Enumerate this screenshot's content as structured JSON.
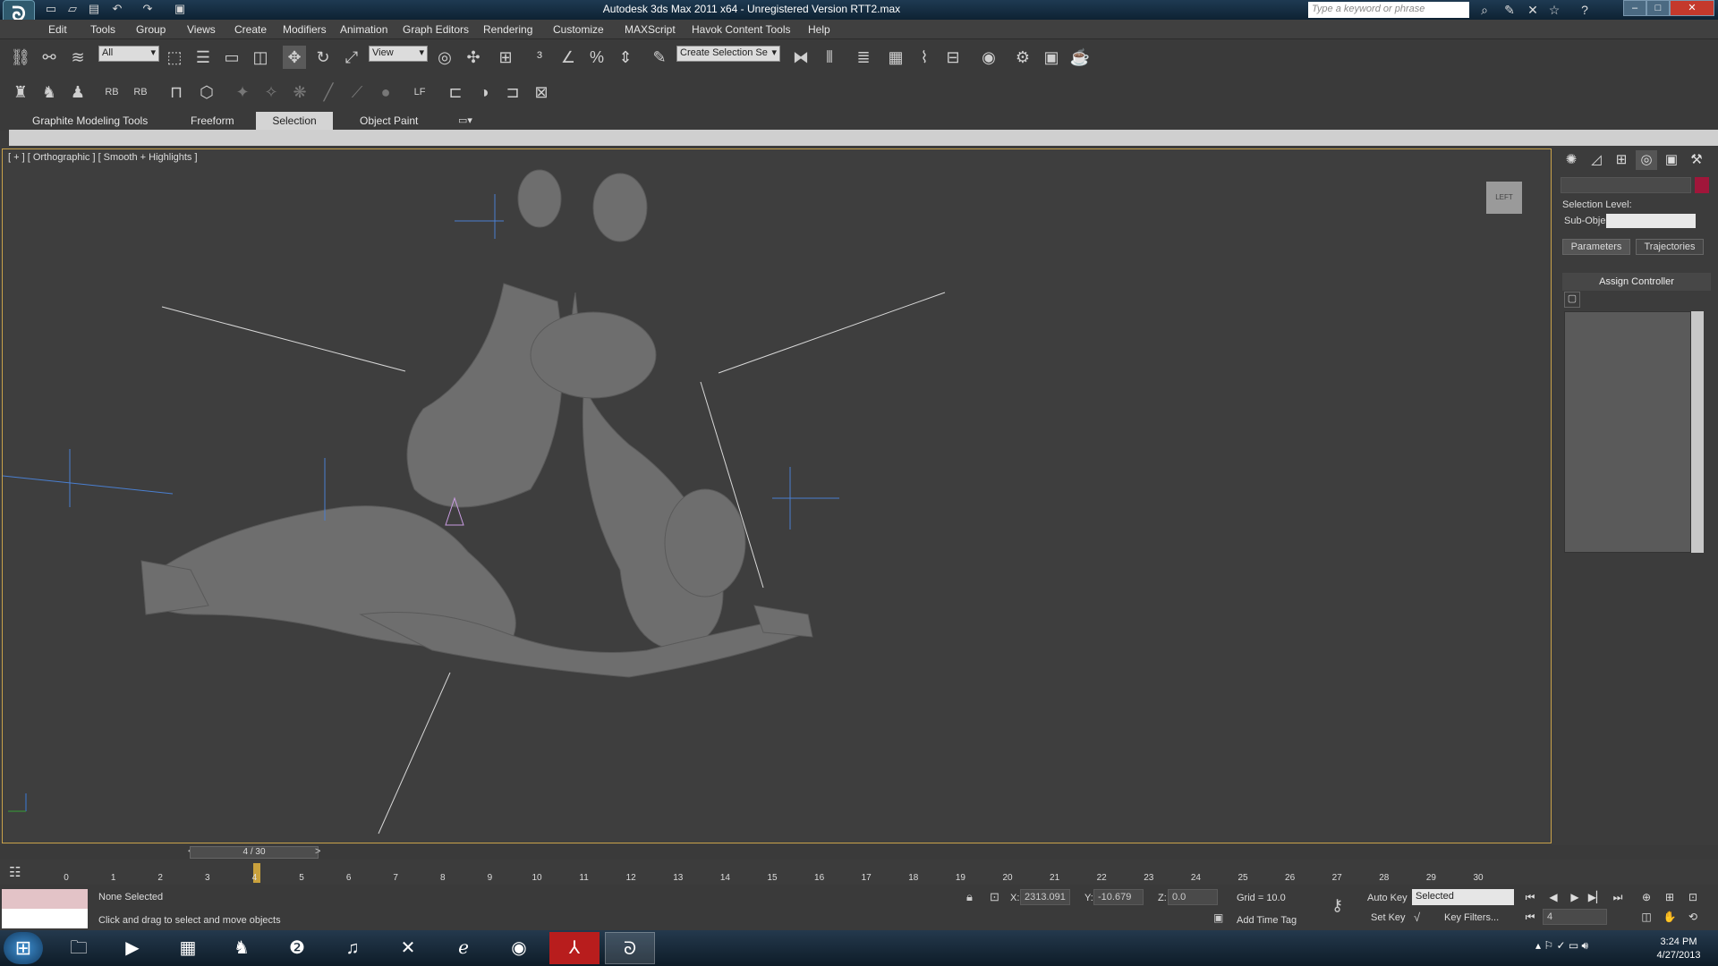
{
  "window": {
    "title": "Autodesk 3ds Max  2011 x64  -  Unregistered Version    RTT2.max",
    "search_placeholder": "Type a keyword or phrase"
  },
  "menu": [
    "Edit",
    "Tools",
    "Group",
    "Views",
    "Create",
    "Modifiers",
    "Animation",
    "Graph Editors",
    "Rendering",
    "Customize",
    "MAXScript",
    "Havok Content Tools",
    "Help"
  ],
  "toolbar": {
    "selection_filter": "All",
    "ref_coord": "View",
    "named_selection": "Create Selection Se"
  },
  "ribbon": {
    "tabs": [
      "Graphite Modeling Tools",
      "Freeform",
      "Selection",
      "Object Paint"
    ],
    "active": "Selection"
  },
  "viewport": {
    "label": "[ + ] [ Orthographic ] [ Smooth + Highlights ]",
    "viewcube": "LEFT"
  },
  "command_panel": {
    "selection_level": "Selection Level:",
    "sub_object": "Sub-Object",
    "tabs": [
      "Parameters",
      "Trajectories"
    ],
    "rollout": "Assign Controller"
  },
  "timeline": {
    "frame": "4 / 30",
    "ticks": [
      "0",
      "1",
      "2",
      "3",
      "4",
      "5",
      "6",
      "7",
      "8",
      "9",
      "10",
      "11",
      "12",
      "13",
      "14",
      "15",
      "16",
      "17",
      "18",
      "19",
      "20",
      "21",
      "22",
      "23",
      "24",
      "25",
      "26",
      "27",
      "28",
      "29",
      "30"
    ]
  },
  "status": {
    "selection": "None Selected",
    "prompt": "Click and drag to select and move objects",
    "x_label": "X:",
    "x": "2313.091",
    "y_label": "Y:",
    "y": "-10.679",
    "z_label": "Z:",
    "z": "0.0",
    "grid": "Grid = 10.0",
    "add_time_tag": "Add Time Tag",
    "auto_key": "Auto Key",
    "set_key": "Set Key",
    "key_mode": "Selected",
    "key_filters": "Key Filters...",
    "current_frame": "4"
  },
  "taskbar": {
    "time": "3:24 PM",
    "date": "4/27/2013"
  },
  "colors": {
    "viewport_bg": "#3e3e3e",
    "accent": "#a0163a",
    "active_viewport_border": "#c9a24a"
  }
}
